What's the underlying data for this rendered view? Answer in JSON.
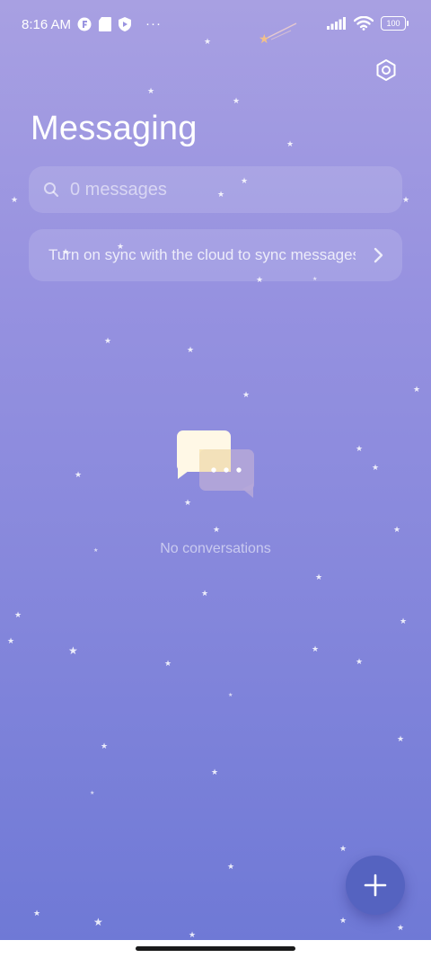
{
  "status_bar": {
    "time": "8:16 AM",
    "more": "···",
    "battery": "100",
    "left_icons": [
      "f-app-icon",
      "sd-card-icon",
      "shield-icon"
    ],
    "right_icons": [
      "signal-icon",
      "wifi-icon",
      "battery-icon"
    ]
  },
  "header": {
    "title": "Messaging",
    "settings_icon": "settings-icon"
  },
  "search": {
    "placeholder": "0 messages",
    "icon": "search-icon"
  },
  "sync_banner": {
    "text": "Turn on sync with the cloud to sync messages",
    "icon": "chevron-right-icon"
  },
  "empty_state": {
    "icon": "chat-bubbles-icon",
    "text": "No conversations"
  },
  "fab": {
    "icon": "plus-icon"
  },
  "colors": {
    "background_top": "#a8a0e2",
    "background_bottom": "#6f79d6",
    "fab": "#5563c0",
    "bubble_front": "#fff8e6",
    "bubble_back": "#b6a8d8"
  }
}
